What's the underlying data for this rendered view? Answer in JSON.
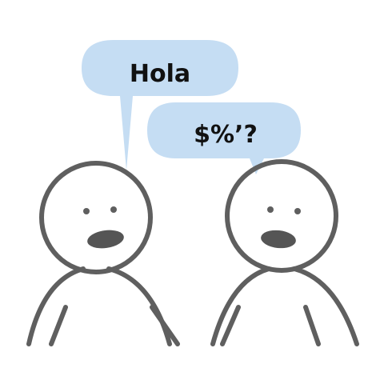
{
  "bubbles": {
    "left_text": "Hola",
    "right_text": "$%’?"
  },
  "colors": {
    "bubble_fill": "#c5ddf3",
    "outline": "#5f5f5f",
    "mouth": "#555555",
    "background": "#ffffff",
    "text": "#111111"
  }
}
